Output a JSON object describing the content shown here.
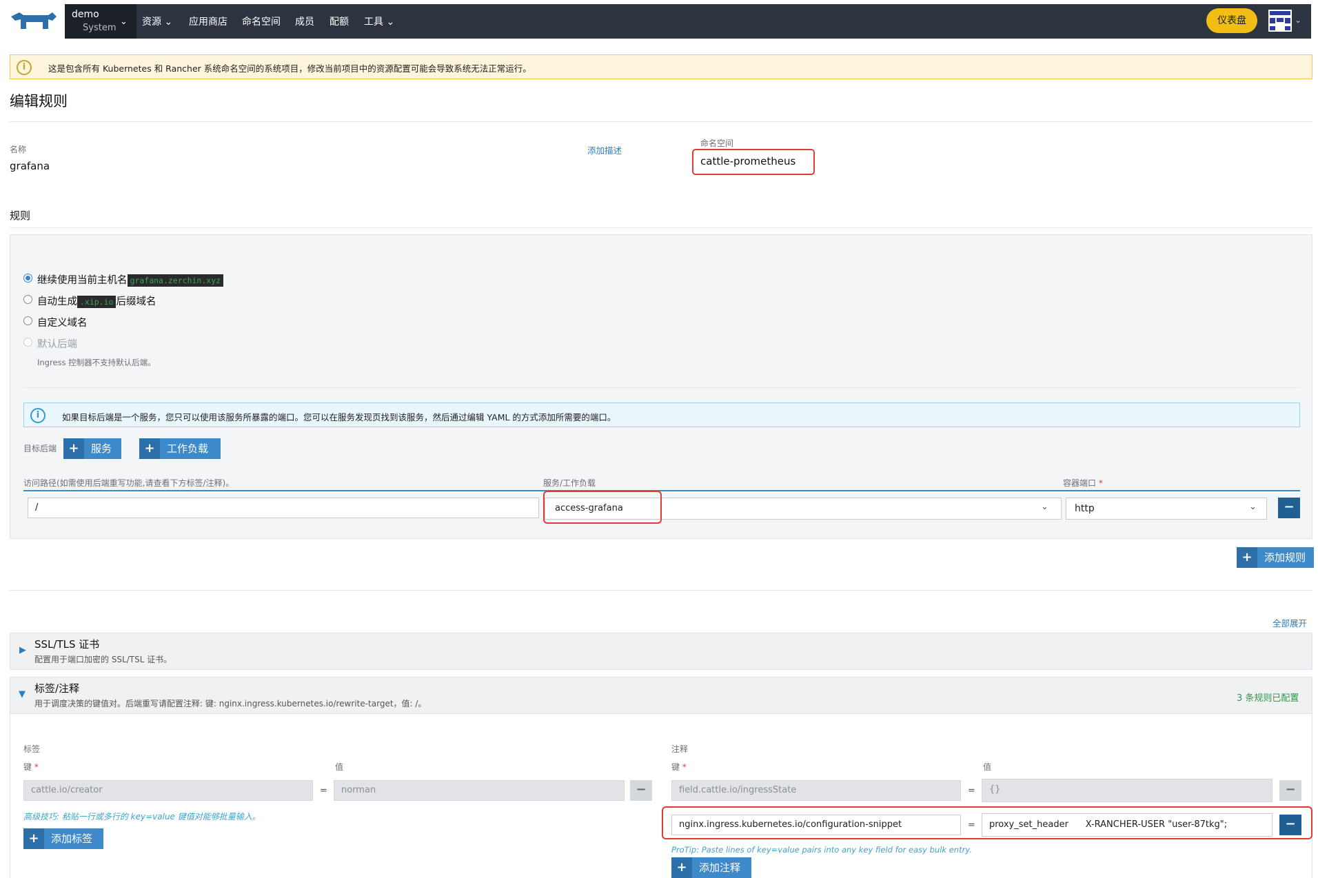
{
  "nav": {
    "cluster_name": "demo",
    "project_name": "System",
    "items": [
      "资源",
      "应用商店",
      "命名空间",
      "成员",
      "配额",
      "工具"
    ],
    "dashboard_label": "仪表盘"
  },
  "banner": {
    "text": "这是包含所有 Kubernetes 和 Rancher 系统命名空间的系统项目，修改当前项目中的资源配置可能会导致系统无法正常运行。"
  },
  "page_title": "编辑规则",
  "name": {
    "label": "名称",
    "value": "grafana",
    "add_desc_link": "添加描述"
  },
  "namespace": {
    "label": "命名空间",
    "value": "cattle-prometheus"
  },
  "rules": {
    "title": "规则",
    "options": [
      {
        "label": "继续使用当前主机名",
        "code": "grafana.zerchin.xyz",
        "suffix": "",
        "checked": true,
        "disabled": false
      },
      {
        "label": "自动生成",
        "code": ".xip.io",
        "suffix": "后缀域名",
        "checked": false,
        "disabled": false
      },
      {
        "label": "自定义域名",
        "code": "",
        "suffix": "",
        "checked": false,
        "disabled": false
      },
      {
        "label": "默认后端",
        "code": "",
        "suffix": "",
        "checked": false,
        "disabled": true
      }
    ],
    "default_backend_note": "Ingress 控制器不支持默认后端。",
    "info_text": "如果目标后端是一个服务，您只可以使用该服务所暴露的端口。您可以在服务发现页找到该服务，然后通过编辑 YAML 的方式添加所需要的端口。",
    "target_label": "目标后端",
    "service_btn": "服务",
    "workload_btn": "工作负载",
    "path_header": "访问路径(如需使用后端重写功能,请查看下方标签/注释)。",
    "svc_header": "服务/工作负载",
    "port_header": "容器端口",
    "path_value": "/",
    "svc_value": "access-grafana",
    "port_value": "http",
    "add_rule_btn": "添加规则"
  },
  "expand_all": "全部展开",
  "ssl": {
    "title": "SSL/TLS 证书",
    "desc": "配置用于端口加密的 SSL/TSL 证书。"
  },
  "labels_section": {
    "title": "标签/注释",
    "desc": "用于调度决策的键值对。后端重写请配置注释: 键: nginx.ingress.kubernetes.io/rewrite-target，值: /。",
    "configured": "3 条规则已配置",
    "labels_title": "标签",
    "annotations_title": "注释",
    "key_label": "键",
    "value_label": "值",
    "labels": [
      {
        "key": "cattle.io/creator",
        "value": "norman"
      }
    ],
    "labels_hint": "高级技巧: 粘贴一行或多行的 key=value 键值对能够批量输入。",
    "add_label_btn": "添加标签",
    "annotations": [
      {
        "key": "field.cattle.io/ingressState",
        "value": "{}"
      },
      {
        "key": "nginx.ingress.kubernetes.io/configuration-snippet",
        "value": "proxy_set_header      X-RANCHER-USER \"user-87tkg\";"
      }
    ],
    "annotations_hint": "ProTip: Paste lines of key=value pairs into any key field for easy bulk entry.",
    "add_annotation_btn": "添加注释"
  }
}
